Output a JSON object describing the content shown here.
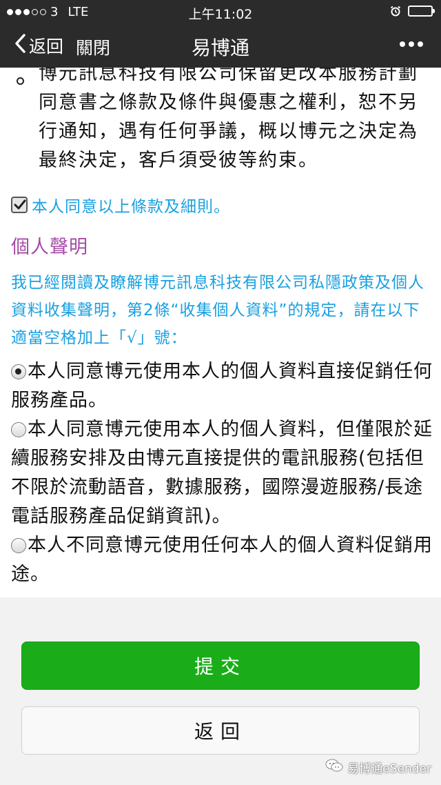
{
  "status_bar": {
    "carrier": "3",
    "network": "LTE",
    "time": "上午11:02"
  },
  "nav": {
    "back_label": "返回",
    "close_label": "關閉",
    "title": "易博通"
  },
  "content": {
    "terms_text": "博元訊息科技有限公司保留更改本服務計劃同意書之條款及條件與優惠之權利，恕不另行通知，遇有任何爭議，概以博元之決定為最終決定，客戶須受彼等約束。",
    "agree_label": "本人同意以上條款及細則。",
    "agree_checked": true,
    "section_title": "個人聲明",
    "statement": "我已經閱讀及瞭解博元訊息科技有限公司私隱政策及個人資料收集聲明，第2條“收集個人資料”的規定，請在以下適當空格加上「√」號：",
    "options": [
      {
        "label": "本人同意博元使用本人的個人資料直接促銷任何服務產品。",
        "selected": true
      },
      {
        "label": "本人同意博元使用本人的個人資料，但僅限於延續服務安排及由博元直接提供的電訊服務(包括但不限於流動語音，數據服務，國際漫遊服務/長途電話服務產品促銷資訊)。",
        "selected": false
      },
      {
        "label": "本人不同意博元使用任何本人的個人資料促銷用途。",
        "selected": false
      }
    ]
  },
  "footer": {
    "submit_label": "提交",
    "back_label": "返回",
    "watermark": "易博通eSender"
  },
  "colors": {
    "bar_bg": "#2b2b2b",
    "link_blue": "#1aa0e0",
    "section_purple": "#a64aa6",
    "submit_green": "#1aad19",
    "footer_bg": "#f2f2f2"
  }
}
